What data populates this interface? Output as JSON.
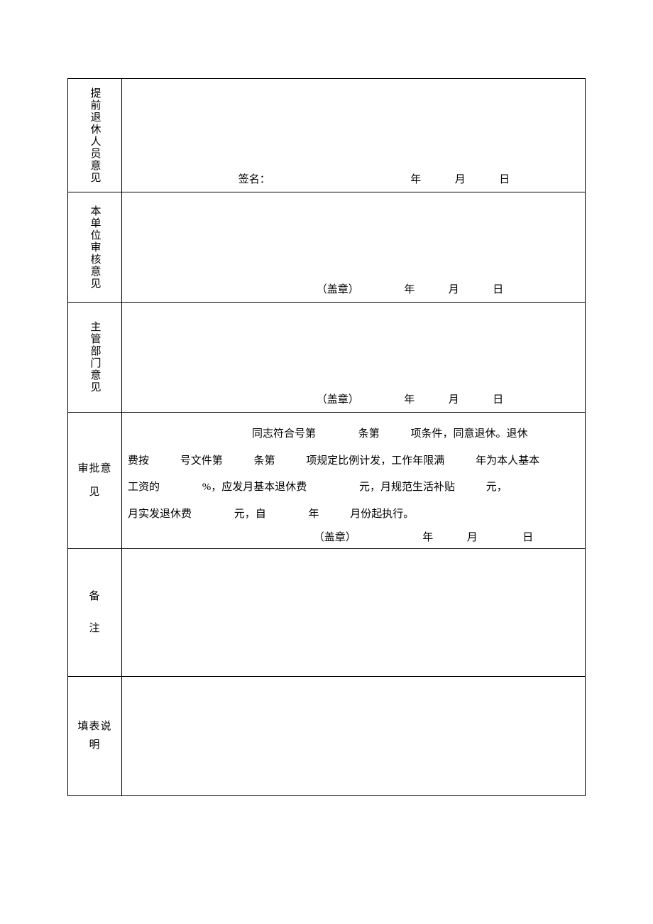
{
  "rows": {
    "r1": {
      "label": "提前退休人员意见",
      "sig": "签名：",
      "year": "年",
      "month": "月",
      "day": "日"
    },
    "r2": {
      "label": "本单位审核意见",
      "stamp": "（盖章）",
      "year": "年",
      "month": "月",
      "day": "日"
    },
    "r3": {
      "label": "主管部门意见",
      "stamp": "（盖章）",
      "year": "年",
      "month": "月",
      "day": "日"
    },
    "r4": {
      "label_l1": "审批意",
      "label_l2": "见",
      "t1": "同志符合号第",
      "t2": "条第",
      "t3": "项条件，同意退休。退休",
      "t4": "费按",
      "t5": "号文件第",
      "t6": "条第",
      "t7": "项规定比例计发，工作年限满",
      "t8": "年为本人基本",
      "t9": "工资的",
      "t10": "%，应发月基本退休费",
      "t11": "元，月规范生活补贴",
      "t12": "元，",
      "t13": "月实发退休费",
      "t14": "元，自",
      "t15": "年",
      "t16": "月份起执行。",
      "stamp": "（盖章）",
      "year": "年",
      "month": "月",
      "day": "日"
    },
    "r5": {
      "label_l1": "备",
      "label_l2": "注"
    },
    "r6": {
      "label_l1": "填表说",
      "label_l2": "明"
    }
  }
}
